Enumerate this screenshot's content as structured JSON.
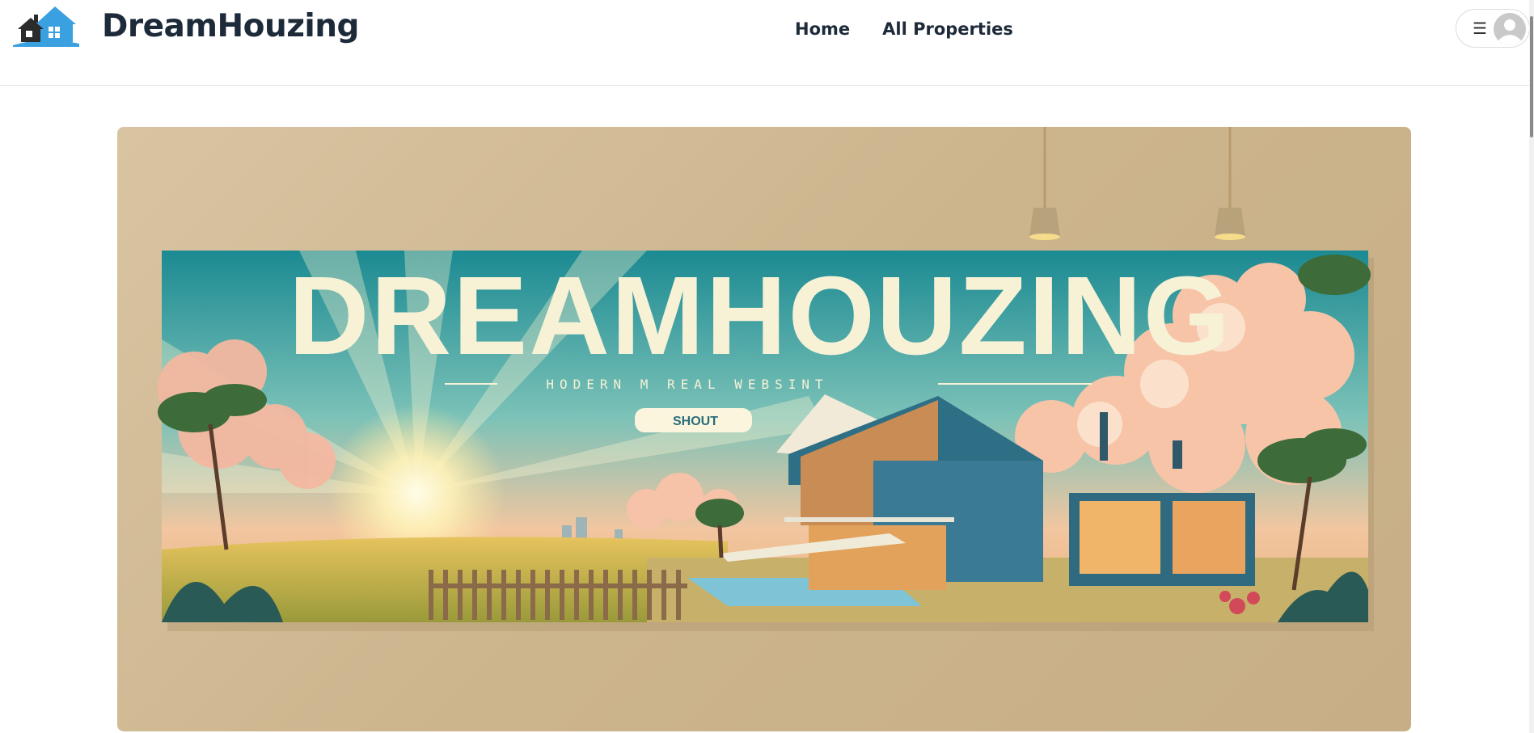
{
  "app": {
    "brand_name": "DreamHouzing"
  },
  "nav": {
    "items": [
      {
        "label": "Home"
      },
      {
        "label": "All Properties"
      }
    ]
  },
  "user_menu": {
    "menu_icon": "hamburger-menu-icon",
    "avatar_icon": "default-avatar-icon"
  },
  "hero": {
    "banner_title": "DREAMHOUZING",
    "banner_subtitle": "HODERN  M   REAL  WEBSINT",
    "banner_button": "SHOUT"
  },
  "colors": {
    "brand_text": "#1d2a3a",
    "logo_blue": "#3aa0e0",
    "hero_sand": "#cdb48c",
    "banner_teal": "#1f8a92"
  }
}
